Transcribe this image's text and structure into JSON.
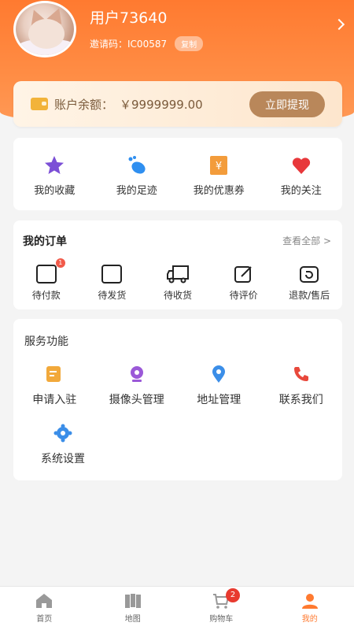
{
  "profile": {
    "username": "用户73640",
    "invite_label": "邀请码：",
    "invite_code": "IC00587",
    "copy_label": "复制"
  },
  "balance": {
    "label": "账户余额：",
    "value": "￥9999999.00",
    "withdraw_label": "立即提现"
  },
  "quick_links": [
    {
      "label": "我的收藏",
      "icon": "star-icon"
    },
    {
      "label": "我的足迹",
      "icon": "footprint-icon"
    },
    {
      "label": "我的优惠券",
      "icon": "coupon-icon"
    },
    {
      "label": "我的关注",
      "icon": "heart-icon"
    }
  ],
  "orders": {
    "title": "我的订单",
    "view_all": "查看全部 >",
    "items": [
      {
        "label": "待付款",
        "badge": "1"
      },
      {
        "label": "待发货"
      },
      {
        "label": "待收货"
      },
      {
        "label": "待评价"
      },
      {
        "label": "退款/售后"
      }
    ]
  },
  "services": {
    "title": "服务功能",
    "items": [
      {
        "label": "申请入驻",
        "icon": "apply-icon"
      },
      {
        "label": "摄像头管理",
        "icon": "camera-icon"
      },
      {
        "label": "地址管理",
        "icon": "location-icon"
      },
      {
        "label": "联系我们",
        "icon": "phone-icon"
      },
      {
        "label": "系统设置",
        "icon": "gear-icon"
      }
    ]
  },
  "tabbar": {
    "items": [
      {
        "label": "首页",
        "icon": "home-icon"
      },
      {
        "label": "地图",
        "icon": "map-icon"
      },
      {
        "label": "购物车",
        "icon": "cart-icon",
        "badge": "2"
      },
      {
        "label": "我的",
        "icon": "user-icon",
        "active": true
      }
    ]
  },
  "colors": {
    "accent": "#ff7a30",
    "withdraw_button": "#b9875a",
    "badge": "#e83a2f"
  }
}
